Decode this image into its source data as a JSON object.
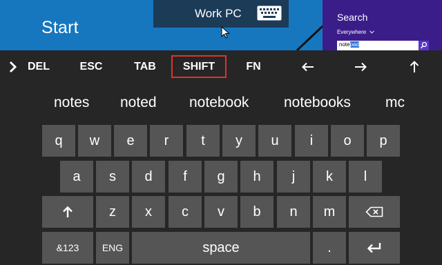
{
  "desktop": {
    "start_title": "Start",
    "connection": {
      "label": "Work PC",
      "icon": "keyboard-icon"
    },
    "search": {
      "title": "Search",
      "scope": "Everywhere",
      "query_typed": "note",
      "query_selected": "pad",
      "button_icon": "search-icon"
    }
  },
  "function_row": {
    "expand_icon": "chevron-right-icon",
    "del": "DEL",
    "esc": "ESC",
    "tab": "TAB",
    "shift": "SHIFT",
    "fn": "FN",
    "left_icon": "arrow-left-icon",
    "right_icon": "arrow-right-icon",
    "up_icon": "arrow-up-icon"
  },
  "suggestions": [
    "notes",
    "noted",
    "notebook",
    "notebooks",
    "mc"
  ],
  "keyboard": {
    "row1": [
      "q",
      "w",
      "e",
      "r",
      "t",
      "y",
      "u",
      "i",
      "o",
      "p"
    ],
    "row2": [
      "a",
      "s",
      "d",
      "f",
      "g",
      "h",
      "j",
      "k",
      "l"
    ],
    "row3": [
      "z",
      "x",
      "c",
      "v",
      "b",
      "n",
      "m"
    ],
    "shift_icon": "shift-arrow-icon",
    "backspace_icon": "backspace-icon",
    "symbols": "&123",
    "language": "ENG",
    "space": "space",
    "period": ".",
    "enter_icon": "enter-icon"
  },
  "colors": {
    "desktop_blue": "#1677bf",
    "search_purple": "#3b1d8a",
    "keyboard_bg": "#262626",
    "key_bg": "#555555",
    "highlight_red": "#e0322c"
  }
}
